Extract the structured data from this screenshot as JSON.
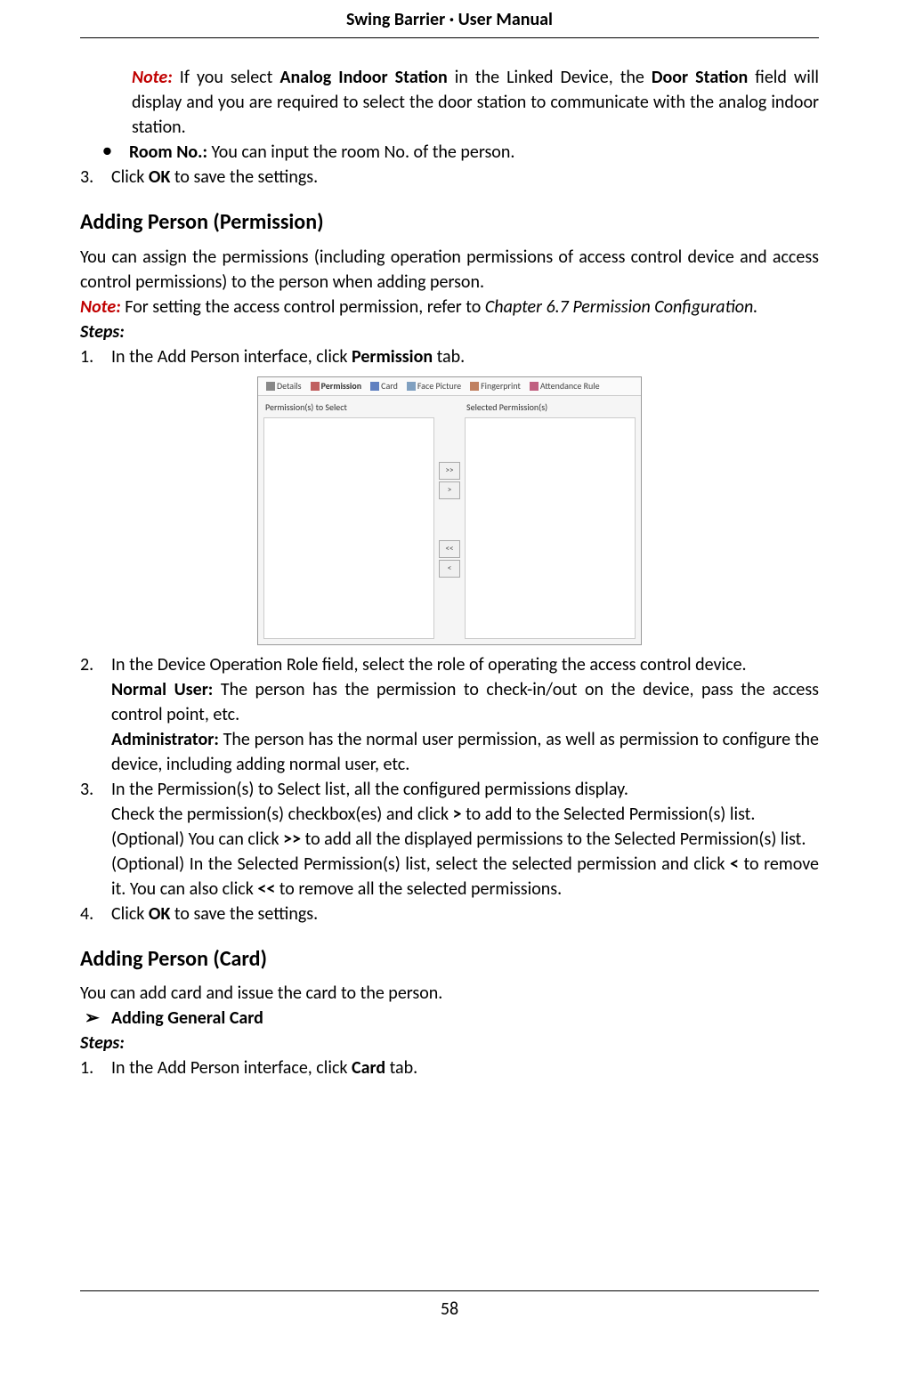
{
  "header": {
    "title": "Swing Barrier · User Manual"
  },
  "intro": {
    "note_label": "Note:",
    "note_text": " If you select ",
    "note_b1": "Analog Indoor Station",
    "note_text2": " in the Linked Device, the ",
    "note_b2": "Door Station",
    "note_text3": " field will display and you are required to select the door station to communicate with the analog indoor station.",
    "room_label": "Room No.:",
    "room_text": " You can input the room No. of the person.",
    "step3_num": "3.",
    "step3_a": "Click ",
    "step3_b": "OK",
    "step3_c": " to save the settings."
  },
  "perm": {
    "heading": "Adding Person (Permission)",
    "intro": "You can assign the permissions (including operation permissions of access control device and access control permissions) to the person when adding person.",
    "note_label": "Note:",
    "note_text_a": " For setting the access control permission, refer to ",
    "note_text_b": "Chapter 6.7 Permission Configuration.",
    "steps_label": "Steps:",
    "s1_num": "1.",
    "s1_a": "In the Add Person interface, click ",
    "s1_b": "Permission",
    "s1_c": " tab.",
    "ui": {
      "tabs": [
        "Details",
        "Permission",
        "Card",
        "Face Picture",
        "Fingerprint",
        "Attendance Rule"
      ],
      "left_label": "Permission(s) to Select",
      "right_label": "Selected Permission(s)",
      "btn_all_right": ">>",
      "btn_right": ">",
      "btn_all_left": "<<",
      "btn_left": "<"
    },
    "s2_num": "2.",
    "s2_text": "In the Device Operation Role field, select the role of operating the access control device.",
    "normal_label": "Normal User:",
    "normal_text": " The person has the permission to check-in/out on the device, pass the access control point, etc.",
    "admin_label": "Administrator:",
    "admin_text": " The person has the normal user permission, as well as permission to configure the device, including adding normal user, etc.",
    "s3_num": "3.",
    "s3_text": "In the Permission(s) to Select list, all the configured permissions display.",
    "s3_line2_a": "Check the permission(s) checkbox(es) and click ",
    "s3_line2_b": ">",
    "s3_line2_c": " to add to the Selected Permission(s) list.",
    "s3_line3_a": "(Optional) You can click ",
    "s3_line3_b": ">>",
    "s3_line3_c": " to add all the displayed permissions to the Selected Permission(s) list.",
    "s3_line4_a": "(Optional) In the Selected Permission(s) list, select the selected permission and click ",
    "s3_line4_b": "<",
    "s3_line4_c": " to remove it. You can also click ",
    "s3_line4_d": "<<",
    "s3_line4_e": " to remove all the selected permissions.",
    "s4_num": "4.",
    "s4_a": "Click ",
    "s4_b": "OK",
    "s4_c": " to save the settings."
  },
  "card": {
    "heading": "Adding Person (Card)",
    "intro": "You can add card and issue the card to the person.",
    "sub": "Adding General Card",
    "steps_label": "Steps:",
    "s1_num": "1.",
    "s1_a": "In the Add Person interface, click ",
    "s1_b": "Card",
    "s1_c": " tab."
  },
  "page_number": "58"
}
